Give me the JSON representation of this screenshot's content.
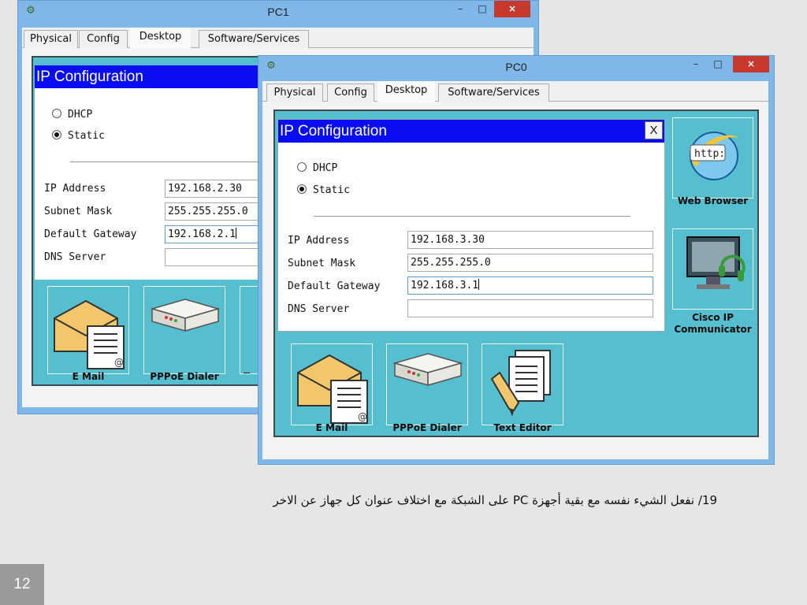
{
  "pc1": {
    "title": "PC1",
    "tabs": [
      "Physical",
      "Config",
      "Desktop",
      "Software/Services"
    ],
    "ip_config": {
      "heading": "IP Configuration",
      "dhcp_label": "DHCP",
      "static_label": "Static",
      "selected_mode": "Static",
      "ip_label": "IP Address",
      "ip_value": "192.168.2.30",
      "mask_label": "Subnet Mask",
      "mask_value": "255.255.255.0",
      "gateway_label": "Default Gateway",
      "gateway_value": "192.168.2.1",
      "dns_label": "DNS Server",
      "dns_value": ""
    },
    "apps": [
      "E Mail",
      "PPPoE Dialer",
      "Te"
    ]
  },
  "pc0": {
    "title": "PC0",
    "tabs": [
      "Physical",
      "Config",
      "Desktop",
      "Software/Services"
    ],
    "ip_config": {
      "heading": "IP Configuration",
      "close_label": "X",
      "dhcp_label": "DHCP",
      "static_label": "Static",
      "selected_mode": "Static",
      "ip_label": "IP Address",
      "ip_value": "192.168.3.30",
      "mask_label": "Subnet Mask",
      "mask_value": "255.255.255.0",
      "gateway_label": "Default Gateway",
      "gateway_value": "192.168.3.1",
      "dns_label": "DNS Server",
      "dns_value": ""
    },
    "apps": [
      "E Mail",
      "PPPoE Dialer",
      "Text Editor"
    ],
    "side_apps": [
      "Web Browser",
      "Cisco IP Communicator"
    ],
    "web_icon_text": "http:"
  },
  "window_buttons": {
    "minimize": "–",
    "maximize": "□",
    "close": "×"
  },
  "caption": "19/ نفعل الشيء نفسه مع بقية أجهزة PC على الشبكة مع اختلاف عنوان كل جهاز عن الاخر",
  "slide_number": "12",
  "colors": {
    "desktop": "#56bfcf",
    "ip_header": "#0a0df0",
    "window_frame": "#7fb7e8",
    "close_button": "#c7392d"
  }
}
